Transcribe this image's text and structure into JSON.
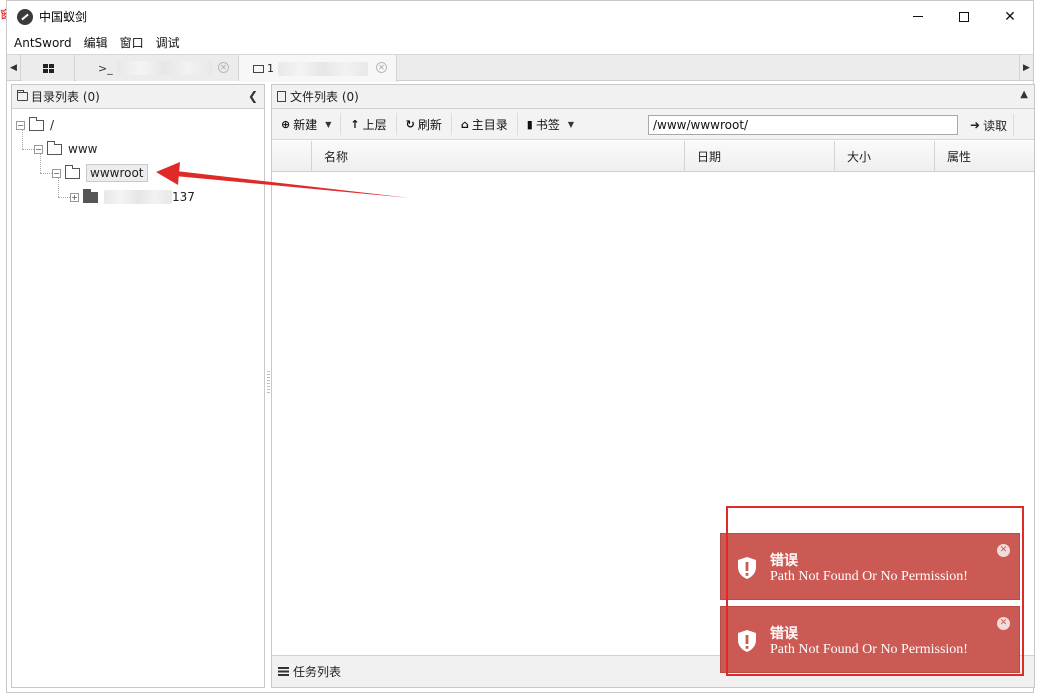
{
  "window": {
    "title": "中国蚁剑",
    "minimize": "—",
    "maximize": "□",
    "close": "✕"
  },
  "menu": [
    "AntSword",
    "编辑",
    "窗口",
    "调试"
  ],
  "tabs": {
    "terminal_prefix": ">_",
    "folder_suffix": "1"
  },
  "left_panel": {
    "title": "目录列表 (0)"
  },
  "tree": {
    "root": "/",
    "level1": "www",
    "level2": "wwwroot",
    "level3_suffix": "137"
  },
  "right_panel": {
    "title": "文件列表 (0)"
  },
  "toolbar": {
    "new": "新建",
    "up": "上层",
    "refresh": "刷新",
    "home": "主目录",
    "bookmark": "书签",
    "path_value": "/www/wwwroot/",
    "read": "读取"
  },
  "columns": [
    "名称",
    "日期",
    "大小",
    "属性"
  ],
  "tasks": {
    "title": "任务列表"
  },
  "notifications": [
    {
      "title": "错误",
      "message": "Path Not Found Or No Permission!"
    },
    {
      "title": "错误",
      "message": "Path Not Found Or No Permission!"
    }
  ],
  "colors": {
    "toast": "#cb5a55",
    "annotation": "#e02a2a"
  }
}
